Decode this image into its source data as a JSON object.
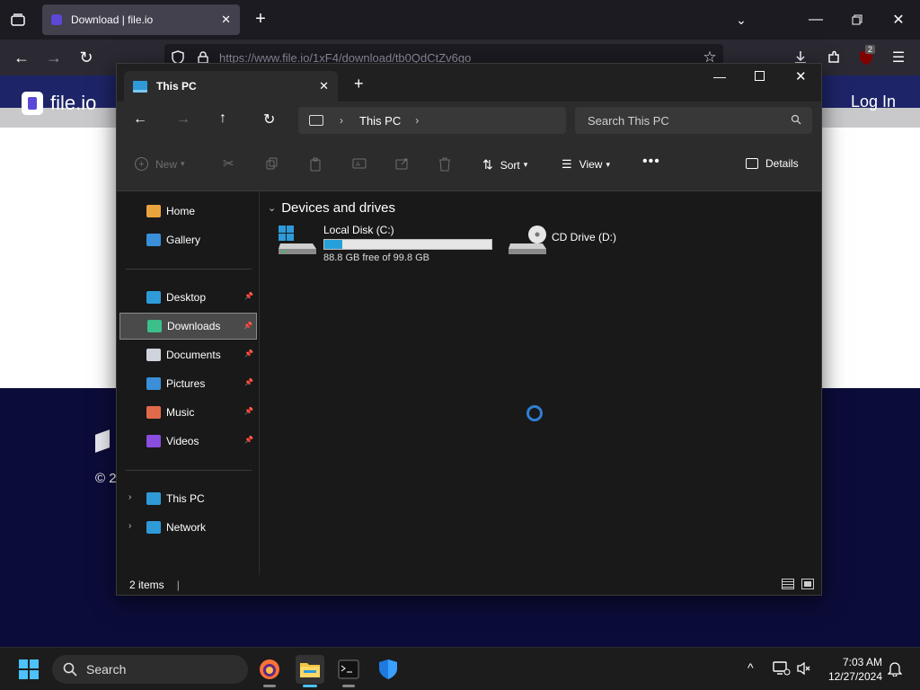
{
  "browser": {
    "tab_title": "Download | file.io",
    "url": "https://www.file.io/1xF4/download/tb0QdCtZv6go",
    "extension_badge": "2"
  },
  "page": {
    "logo_text": "file.io",
    "login": "Log In",
    "footer_copy": "© 2"
  },
  "explorer": {
    "tab_title": "This PC",
    "address_crumb": "This PC",
    "search_placeholder": "Search This PC",
    "toolbar": {
      "new": "New",
      "sort": "Sort",
      "view": "View",
      "details": "Details"
    },
    "nav": [
      {
        "label": "Home",
        "icon": "home-icon",
        "color": "#e8a33c"
      },
      {
        "label": "Gallery",
        "icon": "gallery-icon",
        "color": "#3b8fd9"
      },
      {
        "label": "Desktop",
        "icon": "desktop-icon",
        "color": "#2f9ad8",
        "pinned": true
      },
      {
        "label": "Downloads",
        "icon": "download-icon",
        "color": "#3cbf8a",
        "pinned": true,
        "selected": true
      },
      {
        "label": "Documents",
        "icon": "documents-icon",
        "color": "#cfd4dc",
        "pinned": true
      },
      {
        "label": "Pictures",
        "icon": "pictures-icon",
        "color": "#3b8fd9",
        "pinned": true
      },
      {
        "label": "Music",
        "icon": "music-icon",
        "color": "#e06a4a",
        "pinned": true
      },
      {
        "label": "Videos",
        "icon": "videos-icon",
        "color": "#8a4de0",
        "pinned": true
      },
      {
        "label": "This PC",
        "icon": "this-pc-icon",
        "color": "#2f9ad8"
      },
      {
        "label": "Network",
        "icon": "network-icon",
        "color": "#2f9ad8"
      }
    ],
    "group_title": "Devices and drives",
    "drives": [
      {
        "name": "Local Disk (C:)",
        "free_text": "88.8 GB free of 99.8 GB",
        "used_fraction": 0.11
      },
      {
        "name": "CD Drive (D:)"
      }
    ],
    "status": "2 items"
  },
  "taskbar": {
    "search": "Search",
    "time": "7:03 AM",
    "date": "12/27/2024"
  }
}
